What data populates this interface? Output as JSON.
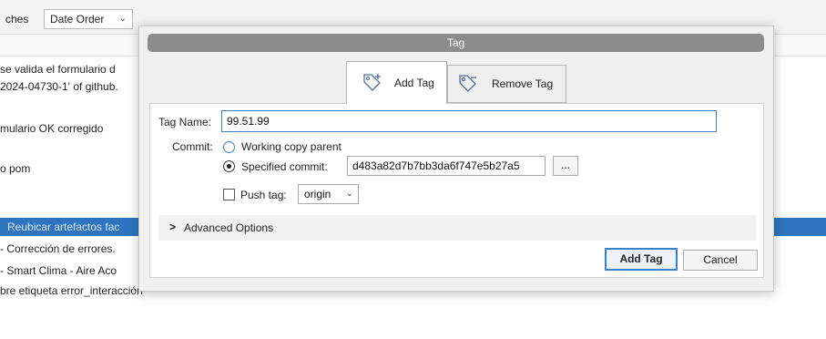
{
  "background": {
    "branches_label": "ches",
    "order_select": "Date Order",
    "commits": [
      {
        "message": "se valida el formulario d",
        "selected": false
      },
      {
        "message": "2024-04730-1' of github.",
        "selected": false
      },
      {
        "message": "mulario OK corregido",
        "selected": false
      },
      {
        "message": "o pom",
        "selected": false
      },
      {
        "message": "Reubicar artefactos fac",
        "selected": true
      },
      {
        "message": "- Corrección de errores.",
        "selected": false
      },
      {
        "message": "- Smart Clima - Aire Aco",
        "selected": false
      },
      {
        "message": "bre etiqueta error_interacción",
        "selected": false
      }
    ]
  },
  "dialog": {
    "title": "Tag",
    "tabs": {
      "add": "Add Tag",
      "remove": "Remove Tag"
    },
    "tag_name_label": "Tag Name:",
    "tag_name_value": "99.51.99",
    "commit_label": "Commit:",
    "working_copy_label": "Working copy parent",
    "specified_commit_label": "Specified commit:",
    "specified_commit_value": "d483a82d7b7bb3da6f747e5b27a5",
    "browse_label": "...",
    "push_tag_label": "Push tag:",
    "remote_value": "origin",
    "advanced_label": "Advanced Options",
    "add_button": "Add Tag",
    "cancel_button": "Cancel"
  },
  "colors": {
    "selection": "#2f74c0",
    "title_bar": "#8c8c8c",
    "focus_border": "#3d7ec9"
  }
}
